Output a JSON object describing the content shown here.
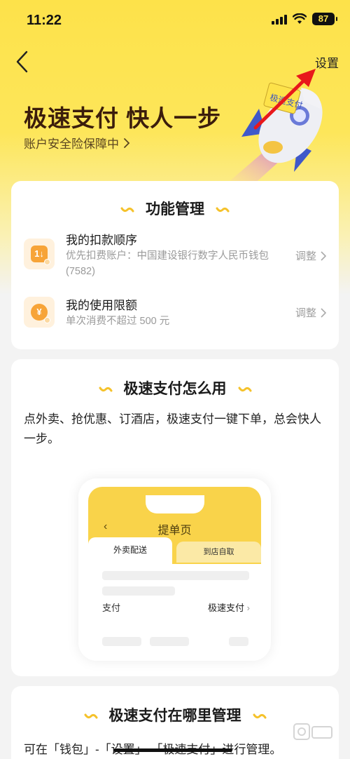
{
  "status_bar": {
    "time": "11:22",
    "battery": "87"
  },
  "nav": {
    "settings_label": "设置"
  },
  "hero": {
    "title": "极速支付 快人一步",
    "subtitle": "账户安全险保障中",
    "rocket_badge": "极速支付"
  },
  "feature_card": {
    "title": "功能管理",
    "items": [
      {
        "name": "我的扣款顺序",
        "desc": "优先扣费账户：中国建设银行数字人民币钱包(7582)",
        "action": "调整",
        "icon": "1↓"
      },
      {
        "name": "我的使用限额",
        "desc": "单次消费不超过 500 元",
        "action": "调整",
        "icon": "¥"
      }
    ]
  },
  "howto_card": {
    "title": "极速支付怎么用",
    "text": "点外卖、抢优惠、订酒店，极速支付一键下单，总会快人一步。",
    "phone": {
      "title": "提单页",
      "tab_active": "外卖配送",
      "tab_inactive": "到店自取",
      "pay_label": "支付",
      "pay_value": "极速支付"
    }
  },
  "where_card": {
    "title": "极速支付在哪里管理",
    "text": "可在「钱包」-「设置」-「极速支付」进行管理。"
  },
  "colors": {
    "accent": "#fde24a",
    "brand_dark": "#3b1d0c",
    "icon_orange": "#f7a438",
    "annotation_red": "#e8181b"
  }
}
